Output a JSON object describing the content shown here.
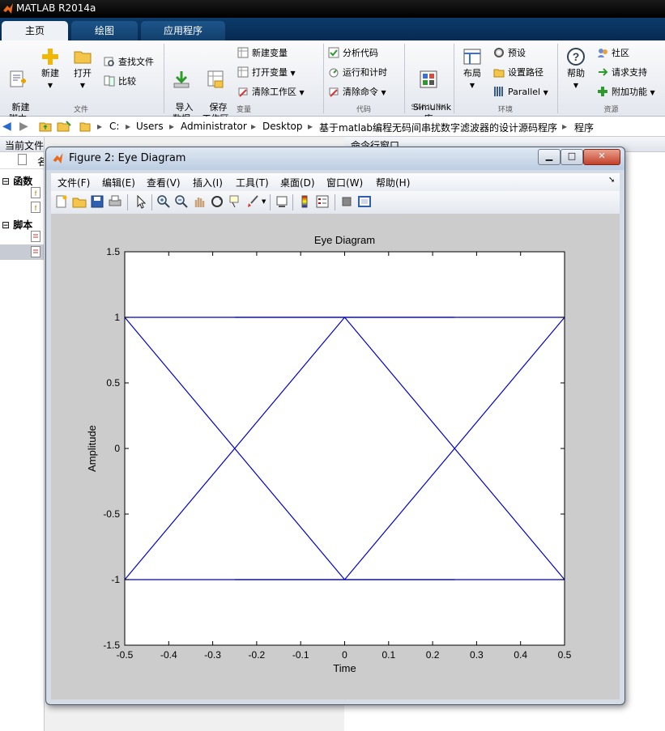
{
  "app": {
    "title": "MATLAB R2014a"
  },
  "ribbon": {
    "tabs": [
      "主页",
      "绘图",
      "应用程序"
    ],
    "buttons": {
      "new_script": "新建\n脚本",
      "new": "新建",
      "open": "打开",
      "find_files": "查找文件",
      "compare": "比较",
      "import_data": "导入\n数据",
      "save_workspace": "保存\n工作区",
      "new_variable": "新建变量",
      "open_variable": "打开变量",
      "clear_workspace": "清除工作区",
      "analyze_code": "分析代码",
      "run_and_time": "运行和计时",
      "clear_commands": "清除命令",
      "simulink": "Simulink\n库",
      "layout": "布局",
      "preferences": "预设",
      "set_path": "设置路径",
      "parallel": "Parallel",
      "help": "帮助",
      "community": "社区",
      "request_support": "请求支持",
      "add_ons": "附加功能"
    },
    "groups": [
      "文件",
      "变量",
      "代码",
      "SIMULINK",
      "环境",
      "资源"
    ]
  },
  "address": {
    "path": [
      "C:",
      "Users",
      "Administrator",
      "Desktop",
      "基于matlab编程无码间串扰数字滤波器的设计源码程序",
      "程序"
    ]
  },
  "left_pane": {
    "title": "当前文件夹",
    "col": "名",
    "sections": [
      "函数",
      "脚本"
    ]
  },
  "cmd_pane": {
    "title": "命令行窗口"
  },
  "figure": {
    "title": "Figure 2: Eye Diagram",
    "menu": [
      "文件(F)",
      "编辑(E)",
      "查看(V)",
      "插入(I)",
      "工具(T)",
      "桌面(D)",
      "窗口(W)",
      "帮助(H)"
    ]
  },
  "colors": {
    "trace": "#0000cc",
    "figure_bg": "#cccccc"
  },
  "chart_data": {
    "type": "line",
    "title": "Eye Diagram",
    "xlabel": "Time",
    "ylabel": "Amplitude",
    "xlim": [
      -0.5,
      0.5
    ],
    "ylim": [
      -1.5,
      1.5
    ],
    "xticks": [
      -0.5,
      -0.4,
      -0.3,
      -0.2,
      -0.1,
      0,
      0.1,
      0.2,
      0.3,
      0.4,
      0.5
    ],
    "yticks": [
      -1.5,
      -1,
      -0.5,
      0,
      0.5,
      1,
      1.5
    ],
    "xtick_labels": [
      "-0.5",
      "-0.4",
      "-0.3",
      "-0.2",
      "-0.1",
      "0",
      "0.1",
      "0.2",
      "0.3",
      "0.4",
      "0.5"
    ],
    "ytick_labels": [
      "-1.5",
      "-1",
      "-0.5",
      "0",
      "0.5",
      "1",
      "1.5"
    ],
    "grid": false,
    "series": [
      {
        "x": [
          -0.5,
          0.5
        ],
        "y": [
          1,
          1
        ]
      },
      {
        "x": [
          -0.5,
          0.5
        ],
        "y": [
          -1,
          -1
        ]
      },
      {
        "x": [
          -0.25,
          0.25
        ],
        "y": [
          1,
          1
        ]
      },
      {
        "x": [
          -0.25,
          0.25
        ],
        "y": [
          -1,
          -1
        ]
      },
      {
        "x": [
          -0.5,
          0
        ],
        "y": [
          1,
          -1
        ]
      },
      {
        "x": [
          -0.5,
          0
        ],
        "y": [
          -1,
          1
        ]
      },
      {
        "x": [
          0,
          0.5
        ],
        "y": [
          1,
          -1
        ]
      },
      {
        "x": [
          0,
          0.5
        ],
        "y": [
          -1,
          1
        ]
      }
    ]
  }
}
